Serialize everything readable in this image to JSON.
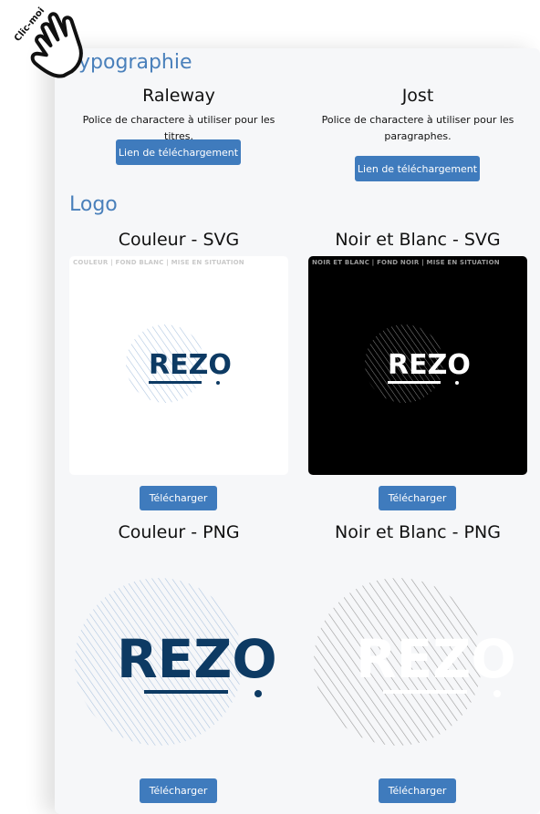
{
  "cursor": {
    "text": "Clic-moi",
    "icon": "pointing-hand-icon"
  },
  "typography": {
    "title": "Typographie",
    "fonts": [
      {
        "name": "Raleway",
        "description": "Police de charactere à utiliser pour les titres.",
        "button": "Lien de téléchargement"
      },
      {
        "name": "Jost",
        "description": "Police de charactere à utiliser pour les paragraphes.",
        "button": "Lien de téléchargement"
      }
    ]
  },
  "logo": {
    "title": "Logo",
    "wordmark": "REZO",
    "svg": [
      {
        "title": "Couleur - SVG",
        "caption": "COULEUR | FOND BLANC | MISE EN SITUATION",
        "button": "Télécharger"
      },
      {
        "title": "Noir et Blanc - SVG",
        "caption": "NOIR ET BLANC | FOND NOIR | MISE EN SITUATION",
        "button": "Télécharger"
      }
    ],
    "png": [
      {
        "title": "Couleur - PNG",
        "button": "Télécharger"
      },
      {
        "title": "Noir et Blanc - PNG",
        "button": "Télécharger"
      }
    ]
  },
  "colors": {
    "accent": "#4a80bb",
    "button": "#3f7bbd",
    "brand_navy": "#0d3a63",
    "hatch_blue": "#9db8d6"
  }
}
